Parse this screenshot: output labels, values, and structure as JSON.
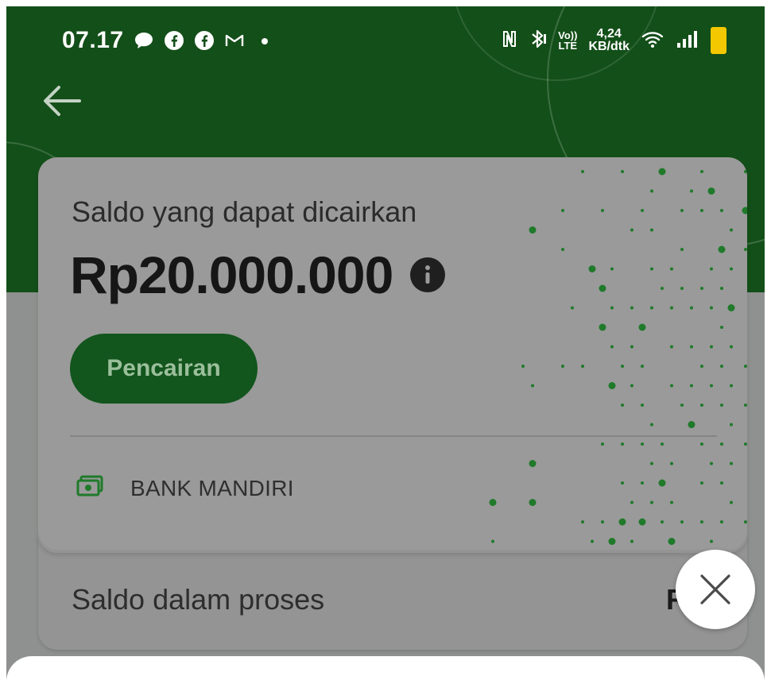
{
  "status_bar": {
    "time": "07.17",
    "net_speed_value": "4,24",
    "net_speed_unit": "KB/dtk",
    "icons_left": [
      "chat-bubble-icon",
      "facebook-icon",
      "facebook-icon",
      "gmail-icon",
      "dot-icon"
    ],
    "icons_right": [
      "nfc-icon",
      "bluetooth-icon",
      "volte-icon",
      "wifi-icon",
      "signal-icon",
      "battery-icon"
    ]
  },
  "nav": {
    "back_icon": "arrow-left-icon"
  },
  "balance_card": {
    "label": "Saldo yang dapat dicairkan",
    "amount": "Rp20.000.000",
    "info_icon": "info-icon",
    "withdraw_button": "Pencairan",
    "bank_icon": "cash-icon",
    "bank_name": "BANK MANDIRI"
  },
  "process_card": {
    "label": "Saldo dalam proses",
    "amount_partial": "Rp"
  },
  "close_button_icon": "close-icon",
  "colors": {
    "header_green": "#134f19",
    "button_green": "#12551d",
    "accent_green": "#1f7a2a",
    "overlay_gray": "#9a9a9a"
  }
}
